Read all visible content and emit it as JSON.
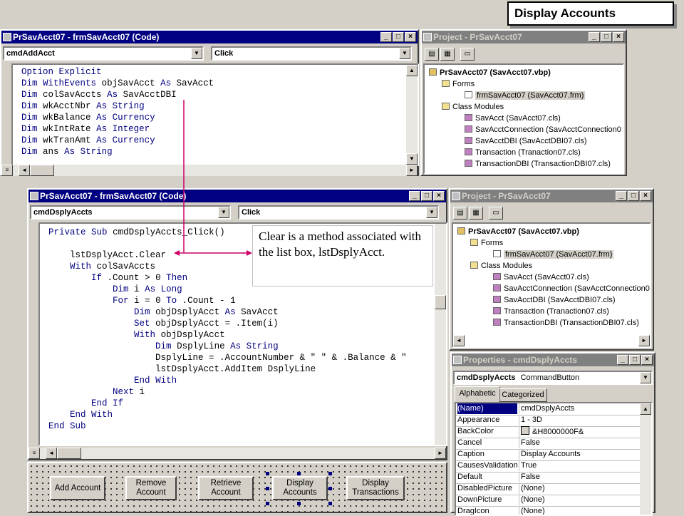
{
  "slide_title": "Display Accounts",
  "top_code_window": {
    "title": "PrSavAcct07 - frmSavAcct07 (Code)",
    "object_combo": "cmdAddAcct",
    "proc_combo": "Click",
    "lines": [
      "Option Explicit",
      "Dim WithEvents objSavAcct As SavAcct",
      "Dim colSavAccts As SavAcctDBI",
      "Dim wkAcctNbr As String",
      "Dim wkBalance As Currency",
      "Dim wkIntRate As Integer",
      "Dim wkTranAmt As Currency",
      "Dim ans As String"
    ]
  },
  "main_code_window": {
    "title": "PrSavAcct07 - frmSavAcct07 (Code)",
    "object_combo": "cmdDsplyAccts",
    "proc_combo": "Click",
    "lines": [
      "Private Sub cmdDsplyAccts_Click()",
      "",
      "    lstDsplyAcct.Clear",
      "    With colSavAccts",
      "        If .Count > 0 Then",
      "            Dim i As Long",
      "            For i = 0 To .Count - 1",
      "                Dim objDsplyAcct As SavAcct",
      "                Set objDsplyAcct = .Item(i)",
      "                With objDsplyAcct",
      "                    Dim DsplyLine As String",
      "                    DsplyLine = .AccountNumber & \" \" & .Balance & \"",
      "                    lstDsplyAcct.AddItem DsplyLine",
      "                End With",
      "            Next i",
      "        End If",
      "    End With",
      "End Sub"
    ]
  },
  "callout_text": "Clear is a method associated with the list box, lstDsplyAcct.",
  "project_explorer": {
    "title": "Project - PrSavAcct07",
    "root": "PrSavAcct07 (SavAcct07.vbp)",
    "forms_folder": "Forms",
    "form_item": "frmSavAcct07 (SavAcct07.frm)",
    "class_folder": "Class Modules",
    "classes": [
      "SavAcct (SavAcct07.cls)",
      "SavAcctConnection (SavAcctConnection0",
      "SavAcctDBI (SavAcctDBI07.cls)",
      "Transaction (Tranaction07.cls)",
      "TransactionDBI (TransactionDBI07.cls)"
    ]
  },
  "properties": {
    "title": "Properties - cmdDsplyAccts",
    "object_name": "cmdDsplyAccts",
    "object_type": "CommandButton",
    "tab_alpha": "Alphabetic",
    "tab_cat": "Categorized",
    "rows": [
      {
        "name": "(Name)",
        "value": "cmdDsplyAccts"
      },
      {
        "name": "Appearance",
        "value": "1 - 3D"
      },
      {
        "name": "BackColor",
        "value": "&H8000000F&"
      },
      {
        "name": "Cancel",
        "value": "False"
      },
      {
        "name": "Caption",
        "value": "Display Accounts"
      },
      {
        "name": "CausesValidation",
        "value": "True"
      },
      {
        "name": "Default",
        "value": "False"
      },
      {
        "name": "DisabledPicture",
        "value": "(None)"
      },
      {
        "name": "DownPicture",
        "value": "(None)"
      },
      {
        "name": "DragIcon",
        "value": "(None)"
      }
    ]
  },
  "form_buttons": [
    "Add Account",
    "Remove\nAccount",
    "Retrieve\nAccount",
    "Display\nAccounts",
    "Display\nTransactions"
  ],
  "colors": {
    "accent": "#cc0066",
    "title_active": "#000080",
    "keyword": "#000080"
  }
}
